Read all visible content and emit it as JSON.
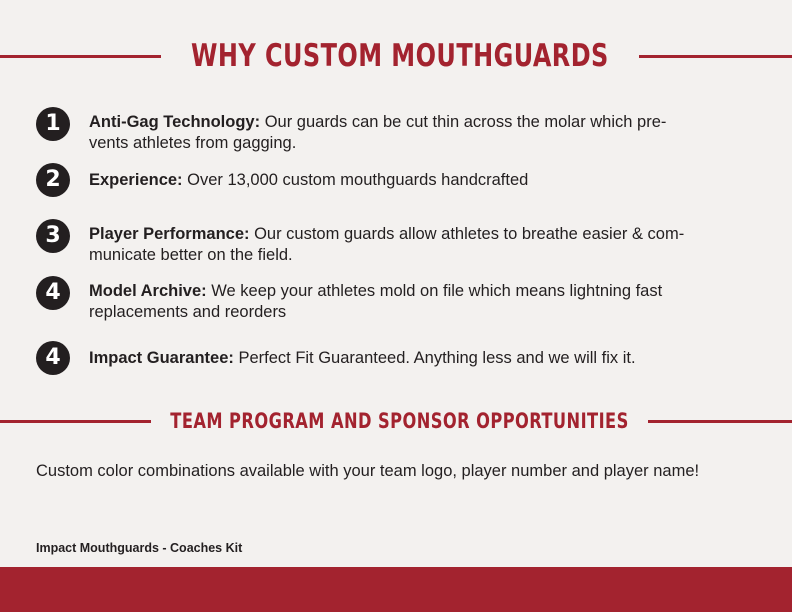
{
  "section1": {
    "heading": "WHY CUSTOM MOUTHGUARDS"
  },
  "items": [
    {
      "number": "1",
      "title": "Anti-Gag Technology:",
      "text": " Our guards can be cut thin across the molar which pre-\nvents athletes from gagging."
    },
    {
      "number": "2",
      "title": "Experience:",
      "text": " Over 13,000 custom mouthguards handcrafted"
    },
    {
      "number": "3",
      "title": "Player Performance:",
      "text": " Our custom guards allow athletes to breathe easier & com-\nmunicate better on the field."
    },
    {
      "number": "4",
      "title": "Model Archive:",
      "text": " We keep your athletes mold on file which means lightning fast\nreplacements and reorders"
    },
    {
      "number": "4",
      "title": "Impact Guarantee:",
      "text": " Perfect Fit Guaranteed. Anything less and we will fix it."
    }
  ],
  "section2": {
    "heading": "TEAM PROGRAM AND SPONSOR OPPORTUNITIES",
    "text": "Custom color combinations available with your team logo, player number and player name!"
  },
  "footer": {
    "label": "Impact Mouthguards - Coaches Kit"
  },
  "colors": {
    "accent": "#a3232f",
    "text": "#231f20",
    "background": "#f3f1ef"
  }
}
